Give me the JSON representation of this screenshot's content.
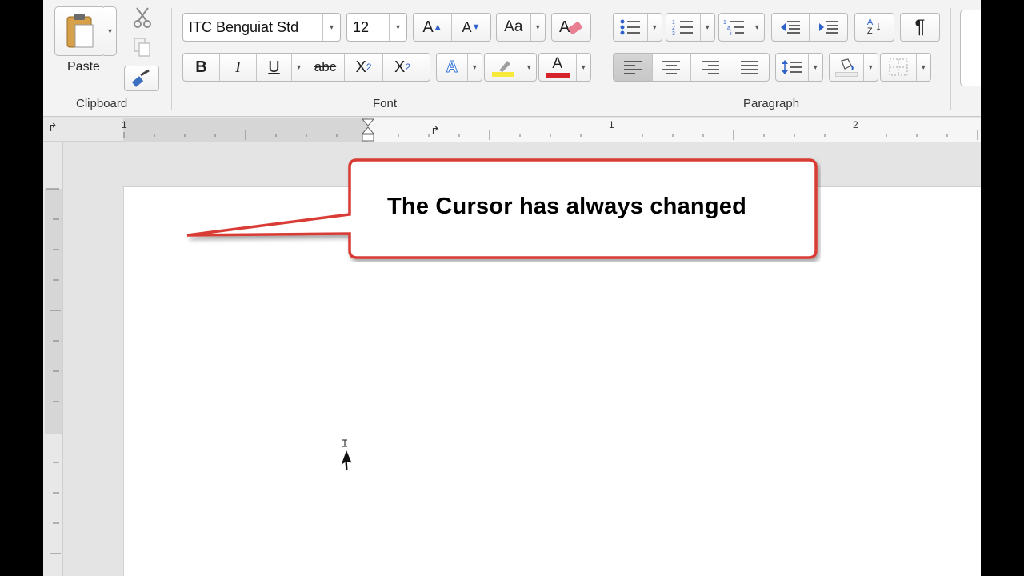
{
  "clipboard": {
    "paste_label": "Paste",
    "group_label": "Clipboard"
  },
  "font": {
    "family": "ITC Benguiat Std",
    "size": "12",
    "group_label": "Font",
    "bold": "B",
    "italic": "I",
    "underline": "U",
    "strikethrough": "abc",
    "subscript": "X",
    "subscript_sub": "2",
    "superscript": "X",
    "superscript_sup": "2",
    "grow": "A",
    "shrink": "A",
    "change_case": "Aa",
    "text_effects": "A",
    "font_color": "A",
    "font_color_value": "#d6232b",
    "highlight_color_value": "#f7ea3c"
  },
  "paragraph": {
    "group_label": "Paragraph",
    "show_marks": "¶",
    "sort_a": "A",
    "sort_z": "Z"
  },
  "ruler": {
    "label_1": "1",
    "label_2": "1",
    "label_3": "2"
  },
  "callout": {
    "text": "The Cursor has always changed",
    "border_color": "#d93a35"
  },
  "icons": {
    "cut": "scissors-icon",
    "copy": "copy-icon",
    "format_painter": "paintbrush-icon",
    "clear_formatting": "eraser-icon",
    "bullets": "bullet-list-icon",
    "numbering": "numbered-list-icon",
    "multilevel": "multilevel-list-icon",
    "decrease_indent": "decrease-indent-icon",
    "increase_indent": "increase-indent-icon",
    "sort": "sort-icon",
    "line_spacing": "line-spacing-icon",
    "shading": "paint-bucket-icon",
    "borders": "borders-icon",
    "cursor": "mouse-pointer-icon"
  }
}
